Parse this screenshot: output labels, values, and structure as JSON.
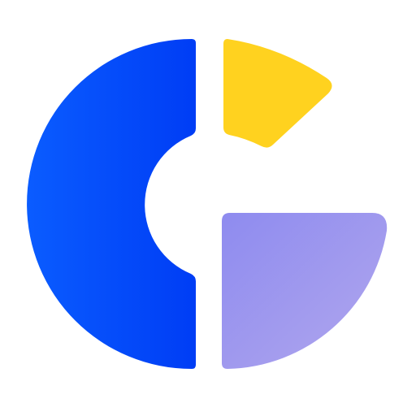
{
  "logo": {
    "icon": "stylized-letter-g-logo",
    "colors": {
      "blue_start": "#0A5CFF",
      "blue_end": "#003DF5",
      "yellow": "#FFD21F",
      "lavender_start": "#8E8BEF",
      "lavender_end": "#B1A7EE"
    }
  }
}
